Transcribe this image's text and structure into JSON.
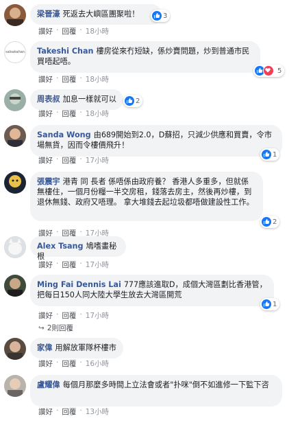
{
  "comments": [
    {
      "author": "梁晉濠",
      "text": "死返去大嶼區團聚啦！",
      "reactions": "3",
      "like": "讚好",
      "reply": "回覆",
      "time": "18小時"
    },
    {
      "author": "Takeshi Chan",
      "text": "樓房從來冇短缺，係炒賣問題，炒到普通市民買唔起唔。",
      "reactions": "5",
      "like": "讚好",
      "reply": "回覆",
      "time": "18小時",
      "avatar_text": "salsakahan"
    },
    {
      "author": "周表叔",
      "text": "加息一樣就可以",
      "reactions": "2",
      "like": "讚好",
      "reply": "回覆",
      "time": "18小時"
    },
    {
      "author": "Sanda Wong",
      "text": "由689開始到2.0，D蘇招，只減少供應和買賣，令市場無貨，因而令樓價飛升！",
      "reactions": "1",
      "like": "讚好",
      "reply": "回覆",
      "time": "17小時"
    },
    {
      "author": "張震宇",
      "text": "港青 同 長者 係唔係由政府養？ 香港人多重多，但就係無樓住，一個月份糧一半交房租，錢落去房主，然後再炒樓，到退休無錢、政府又唔理。 拿大堆錢去起垃圾都唔做建設性工作。",
      "reactions": "2",
      "like": "讚好",
      "reply": "回覆",
      "time": "17小時"
    },
    {
      "author": "Alex Tsang",
      "text": "鳩嗜畫秘根",
      "like": "讚好",
      "reply": "回覆",
      "time": "17小時"
    },
    {
      "author": "Ming Fai Dennis Lai",
      "text": "777應該進取D，成個大灣區劃比香港管，把每日150人同大陸大學生放去大灣區開荒",
      "reactions": "1",
      "like": "讚好",
      "reply": "回覆",
      "time": "17小時",
      "replies": "2則回覆"
    },
    {
      "author": "家偉",
      "text": "用解放軍隊杯樓市",
      "like": "讚好",
      "reply": "回覆",
      "time": "16小時"
    },
    {
      "author": "盧耀偉",
      "text": "每個月那麼多時間上立法會或者\"扑咪\"倒不如進修一下監下咨",
      "like": "讚好",
      "reply": "回覆",
      "time": "13小時"
    }
  ],
  "colors": {
    "like": "#1877f2",
    "love": "#f33e58",
    "author": "#385898",
    "bubble": "#f2f3f5"
  }
}
